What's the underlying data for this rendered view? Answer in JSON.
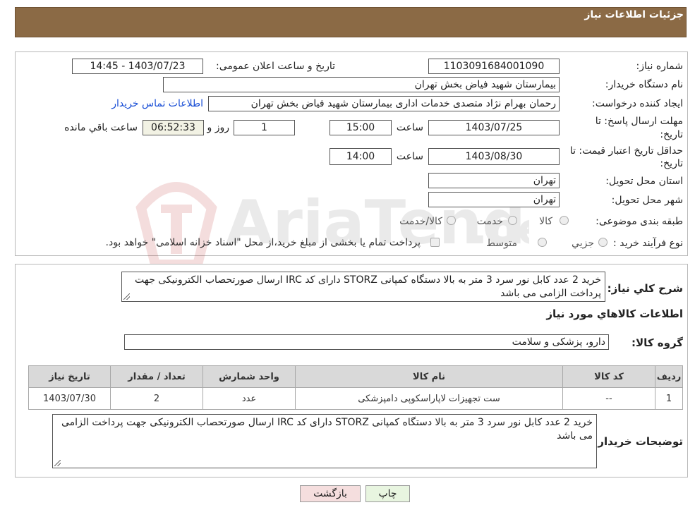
{
  "page": {
    "title": "جزئیات اطلاعات نیاز"
  },
  "form": {
    "need_number_label": "شماره نیاز:",
    "need_number": "1103091684001090",
    "announce_label": "تاریخ و ساعت اعلان عمومی:",
    "announce_value": "1403/07/23 - 14:45",
    "buyer_org_label": "نام دستگاه خریدار:",
    "buyer_org": "بیمارستان شهید فیاض بخش تهران",
    "requester_label": "ایجاد کننده درخواست:",
    "requester": "رحمان بهرام نژاد متصدی خدمات اداری بیمارستان شهید فیاض بخش تهران",
    "contact_link": "اطلاعات تماس خریدار",
    "deadline_label_1": "مهلت ارسال پاسخ: تا",
    "deadline_label_2": "تاریخ:",
    "deadline_date": "1403/07/25",
    "time_label": "ساعت",
    "deadline_time": "15:00",
    "days_value": "1",
    "days_label": "روز و",
    "remaining_time": "06:52:33",
    "remaining_label": "ساعت باقي مانده",
    "validity_label_1": "حداقل تاریخ اعتبار قیمت: تا",
    "validity_label_2": "تاریخ:",
    "validity_date": "1403/08/30",
    "validity_time": "14:00",
    "province_label": "استان محل تحویل:",
    "province": "تهران",
    "city_label": "شهر محل تحویل:",
    "city": "تهران",
    "category_label": "طبقه بندی موضوعی:",
    "category_options": [
      "کالا",
      "خدمت",
      "کالا/خدمت"
    ],
    "process_label": "نوع فرآیند خرید :",
    "process_options": [
      "جزیي",
      "متوسط"
    ],
    "process_note": "پرداخت تمام یا بخشی از مبلغ خرید،از محل \"اسناد خزانه اسلامی\" خواهد بود."
  },
  "details": {
    "desc_label": "شرح کلي نیاز:",
    "desc_text": "خرید 2 عدد کابل نور سرد 3 متر به بالا دستگاه کمپانی STORZ دارای کد IRC ارسال صورتحصاب الکترونیکی جهت پرداخت الزامی می باشد",
    "goods_info_title": "اطلاعات کالاهاي مورد نیاز",
    "goods_group_label": "گروه کالا:",
    "goods_group": "دارو، پزشکی و سلامت"
  },
  "table": {
    "headers": [
      "ردیف",
      "کد کالا",
      "نام کالا",
      "واحد شمارش",
      "تعداد / مقدار",
      "تاریخ نیاز"
    ],
    "rows": [
      [
        "1",
        "--",
        "ست تجهیزات لاپاراسکوپی دامپزشکی",
        "عدد",
        "2",
        "1403/07/30"
      ]
    ]
  },
  "buyer_notes": {
    "label": "توضیحات خریدار:",
    "text": "خرید 2 عدد کابل نور سرد 3 متر به بالا دستگاه کمپانی STORZ دارای کد IRC ارسال صورتحصاب الکترونیکی جهت پرداخت الزامی می باشد"
  },
  "buttons": {
    "print": "چاپ",
    "back": "بازگشت"
  },
  "colors": {
    "header": "#8b6a45",
    "link": "#1a4fd6",
    "back_button": "#f5dede",
    "print_button": "#e8f5e0"
  }
}
